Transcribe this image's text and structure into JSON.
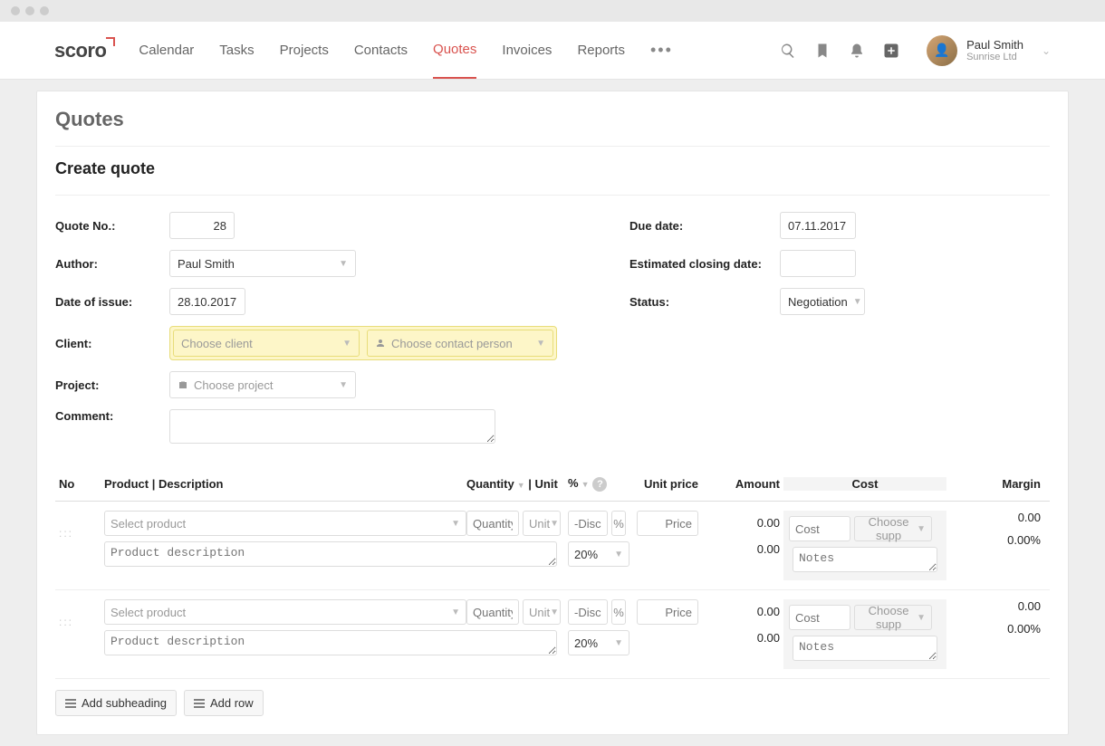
{
  "nav": {
    "logo": "scoro",
    "links": [
      "Calendar",
      "Tasks",
      "Projects",
      "Contacts",
      "Quotes",
      "Invoices",
      "Reports"
    ],
    "active": "Quotes"
  },
  "user": {
    "name": "Paul Smith",
    "org": "Sunrise Ltd"
  },
  "page": {
    "title": "Quotes",
    "subtitle": "Create quote"
  },
  "labels": {
    "quote_no": "Quote No.:",
    "author": "Author:",
    "date_of_issue": "Date of issue:",
    "client": "Client:",
    "project": "Project:",
    "comment": "Comment:",
    "due_date": "Due date:",
    "est_closing": "Estimated closing date:",
    "status": "Status:"
  },
  "form": {
    "quote_no": "28",
    "author": "Paul Smith",
    "date_of_issue": "28.10.2017",
    "client_placeholder": "Choose client",
    "contact_placeholder": "Choose contact person",
    "project_placeholder": "Choose project",
    "due_date": "07.11.2017",
    "est_closing": "",
    "status": "Negotiation"
  },
  "table": {
    "headers": {
      "no": "No",
      "product": "Product | Description",
      "quantity": "Quantity",
      "unit": "| Unit",
      "pct": "%",
      "unit_price": "Unit price",
      "amount": "Amount",
      "cost": "Cost",
      "margin": "Margin"
    },
    "placeholders": {
      "select_product": "Select product",
      "quantity": "Quantity",
      "unit": "Unit",
      "disc": "-Disc.",
      "pct_sign": "%",
      "price": "Price",
      "cost": "Cost",
      "supplier": "Choose supp",
      "notes": "Notes",
      "description": "Product description"
    },
    "rows": [
      {
        "discount_default": "20%",
        "amount": "0.00",
        "amount2": "0.00",
        "margin": "0.00",
        "margin_pct": "0.00%"
      },
      {
        "discount_default": "20%",
        "amount": "0.00",
        "amount2": "0.00",
        "margin": "0.00",
        "margin_pct": "0.00%"
      }
    ]
  },
  "buttons": {
    "add_subheading": "Add subheading",
    "add_row": "Add row"
  }
}
